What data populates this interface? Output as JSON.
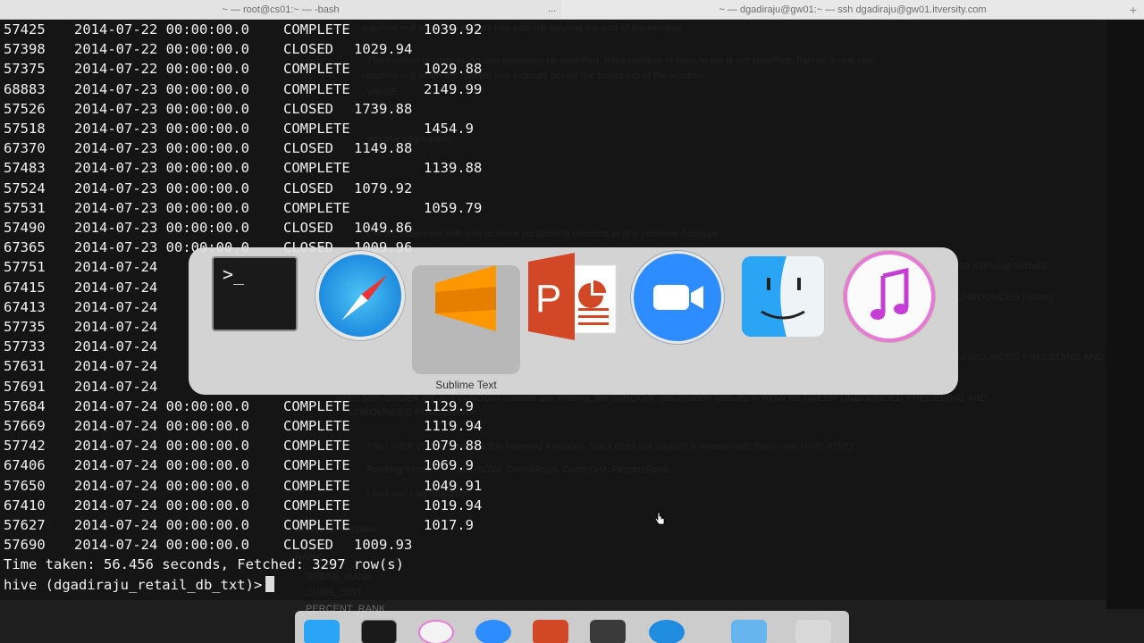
{
  "titlebars": {
    "left_title": "~ — root@cs01:~ — -bash",
    "left_menu": "...",
    "right_title": "~ — dgadiraju@gw01:~ — ssh dgadiraju@gw01.itversity.com",
    "right_plus": "+"
  },
  "terminal": {
    "rows": [
      {
        "id": "57425",
        "date": "2014-07-22 00:00:00.0",
        "status": "COMPLETE",
        "amount": "1039.92"
      },
      {
        "id": "57398",
        "date": "2014-07-22 00:00:00.0",
        "status": "CLOSED",
        "amount": "1029.94"
      },
      {
        "id": "57375",
        "date": "2014-07-22 00:00:00.0",
        "status": "COMPLETE",
        "amount": "1029.88"
      },
      {
        "id": "68883",
        "date": "2014-07-23 00:00:00.0",
        "status": "COMPLETE",
        "amount": "2149.99"
      },
      {
        "id": "57526",
        "date": "2014-07-23 00:00:00.0",
        "status": "CLOSED",
        "amount": "1739.88"
      },
      {
        "id": "57518",
        "date": "2014-07-23 00:00:00.0",
        "status": "COMPLETE",
        "amount": "1454.9"
      },
      {
        "id": "67370",
        "date": "2014-07-23 00:00:00.0",
        "status": "CLOSED",
        "amount": "1149.88"
      },
      {
        "id": "57483",
        "date": "2014-07-23 00:00:00.0",
        "status": "COMPLETE",
        "amount": "1139.88"
      },
      {
        "id": "57524",
        "date": "2014-07-23 00:00:00.0",
        "status": "CLOSED",
        "amount": "1079.92"
      },
      {
        "id": "57531",
        "date": "2014-07-23 00:00:00.0",
        "status": "COMPLETE",
        "amount": "1059.79"
      },
      {
        "id": "57490",
        "date": "2014-07-23 00:00:00.0",
        "status": "CLOSED",
        "amount": "1049.86"
      },
      {
        "id": "67365",
        "date": "2014-07-23 00:00:00.0",
        "status": "CLOSED",
        "amount": "1009.96"
      },
      {
        "id": "57751",
        "date": "2014-07-24",
        "status": "",
        "amount": ""
      },
      {
        "id": "67415",
        "date": "2014-07-24",
        "status": "",
        "amount": ""
      },
      {
        "id": "67413",
        "date": "2014-07-24",
        "status": "",
        "amount": ""
      },
      {
        "id": "57735",
        "date": "2014-07-24",
        "status": "",
        "amount": ""
      },
      {
        "id": "57733",
        "date": "2014-07-24",
        "status": "",
        "amount": ""
      },
      {
        "id": "57631",
        "date": "2014-07-24",
        "status": "",
        "amount": ""
      },
      {
        "id": "57691",
        "date": "2014-07-24",
        "status": "",
        "amount": ""
      },
      {
        "id": "57684",
        "date": "2014-07-24 00:00:00.0",
        "status": "COMPLETE",
        "amount": "1129.9"
      },
      {
        "id": "57669",
        "date": "2014-07-24 00:00:00.0",
        "status": "COMPLETE",
        "amount": "1119.94"
      },
      {
        "id": "57742",
        "date": "2014-07-24 00:00:00.0",
        "status": "COMPLETE",
        "amount": "1079.88"
      },
      {
        "id": "67406",
        "date": "2014-07-24 00:00:00.0",
        "status": "COMPLETE",
        "amount": "1069.9"
      },
      {
        "id": "57650",
        "date": "2014-07-24 00:00:00.0",
        "status": "COMPLETE",
        "amount": "1049.91"
      },
      {
        "id": "67410",
        "date": "2014-07-24 00:00:00.0",
        "status": "COMPLETE",
        "amount": "1019.94"
      },
      {
        "id": "57627",
        "date": "2014-07-24 00:00:00.0",
        "status": "COMPLETE",
        "amount": "1017.9"
      },
      {
        "id": "57690",
        "date": "2014-07-24 00:00:00.0",
        "status": "CLOSED",
        "amount": "1009.93"
      }
    ],
    "time_taken": "Time taken: 56.456 seconds, Fetched: 3297 row(s)",
    "prompt": "hive (dgadiraju_retail_db_txt)>"
  },
  "background_doc": {
    "lines": [
      "columns null when the current row extends beyond the end of the window.",
      "The number of rows to lag can optionally be specified. If the number of rows to lag is not specified, the lag is one row.",
      "columns null when the current row extends before the beginning of the window.",
      "VALUE",
      "VALUE",
      "window aggregates:",
      "ON BY statement with one or more partitioning columns of any primitive datatype.",
      "the following formats",
      "UNBOUNDED | [num]",
      "UNBOUNDED PRECEDING AND",
      "when both ORDER BY and WINDOW clauses are missing, the WINDOW specification defaults to ROW BETWEEN UNBOUNDED PRECEDING AND",
      "UNBOUNDED FOLLOWING",
      "The OVER clause supports the following functions, but it does not support a window with them (see HIVE-4797):",
      "Ranking functions: Rank, NTile, DenseRank, CumeDist, PercentRank.",
      "Lead and Lag functions.",
      "Analytics functions",
      "RANK",
      "DENSE_RANK",
      "CUME_DIST",
      "PERCENT_RANK"
    ]
  },
  "app_switcher": {
    "selected_label": "Sublime Text",
    "apps": [
      "terminal-icon",
      "safari-icon",
      "sublime-text-icon",
      "powerpoint-icon",
      "zoom-icon",
      "finder-icon",
      "itunes-icon"
    ],
    "terminal_prompt_glyph": ">_"
  },
  "dock": {
    "icons": [
      "finder-icon",
      "terminal-icon",
      "itunes-icon",
      "zoom-icon",
      "powerpoint-icon",
      "sublime-text-icon",
      "safari-icon",
      "folder-icon",
      "trash-icon"
    ]
  },
  "colors": {
    "terminal_bg": "#141414",
    "terminal_text": "#f2f2f2",
    "switcher_bg": "#e2e2e2",
    "sublime_orange": "#ff9800",
    "ppt_red": "#d24726",
    "zoom_blue": "#2d8cff"
  }
}
